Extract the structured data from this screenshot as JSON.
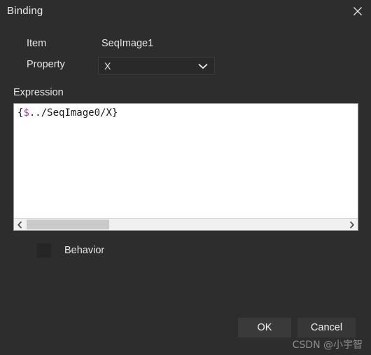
{
  "dialog": {
    "title": "Binding",
    "close_icon": "close-icon"
  },
  "form": {
    "item_label": "Item",
    "item_value": "SeqImage1",
    "property_label": "Property",
    "property_value": "X",
    "property_options": [
      "X"
    ],
    "dropdown_icon": "chevron-down-icon"
  },
  "expression": {
    "label": "Expression",
    "prefix": "{",
    "variable": "$",
    "suffix": "../SeqImage0/X}",
    "full_text": "{$../SeqImage0/X}",
    "variable_color": "#9b3fa0",
    "scrollbar": {
      "left_arrow_icon": "chevron-left-icon",
      "right_arrow_icon": "chevron-right-icon"
    }
  },
  "behavior": {
    "label": "Behavior",
    "checked": false
  },
  "footer": {
    "ok_label": "OK",
    "cancel_label": "Cancel"
  },
  "watermark": {
    "text": "CSDN @小宇智"
  }
}
